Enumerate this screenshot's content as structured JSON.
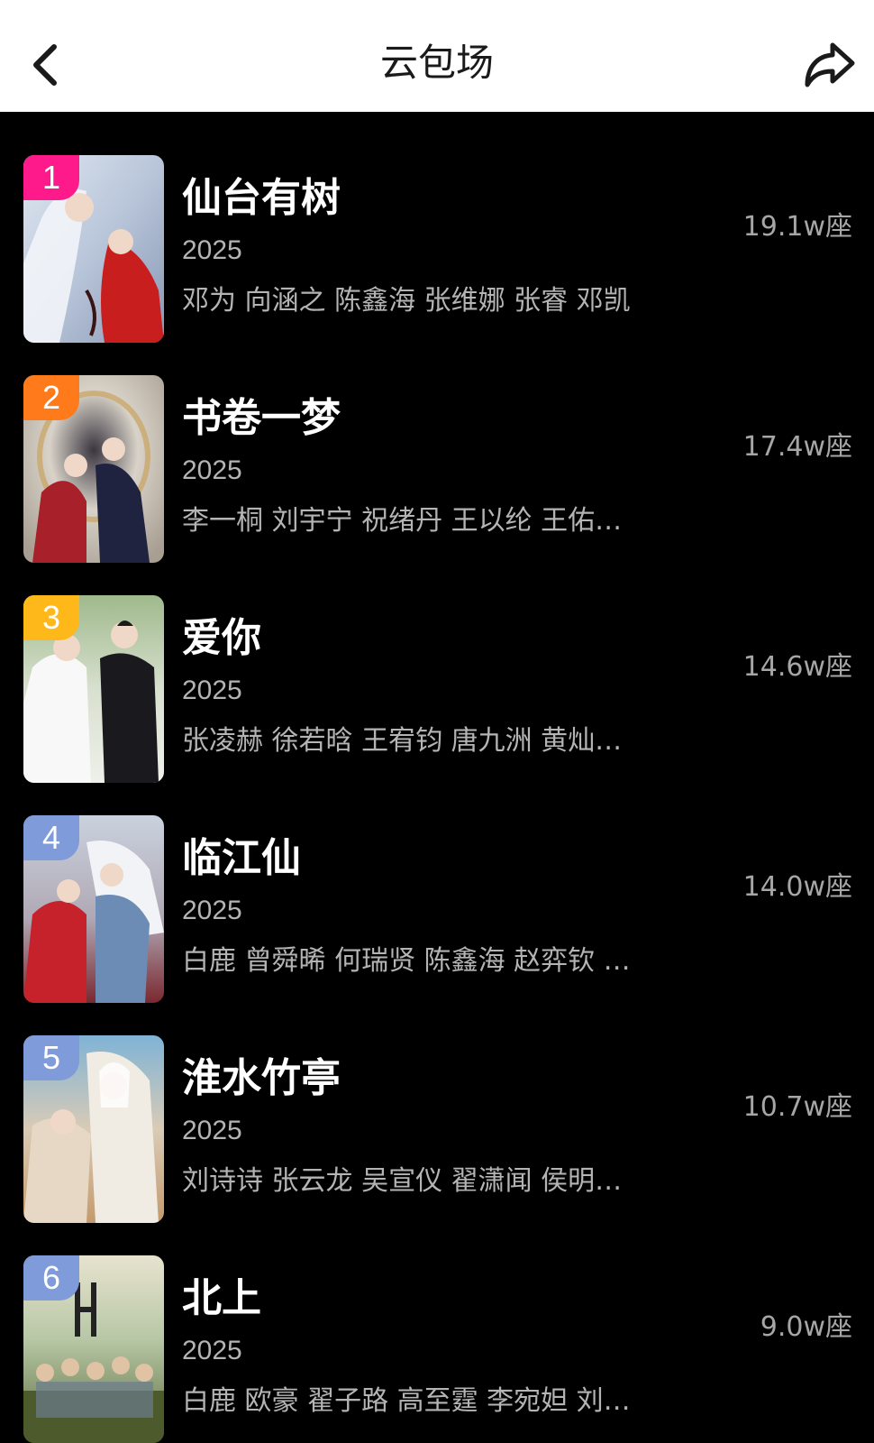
{
  "header": {
    "title": "云包场",
    "back_icon": "chevron-left-icon",
    "share_icon": "share-arrow-icon"
  },
  "items": [
    {
      "rank": "1",
      "title": "仙台有树",
      "year": "2025",
      "cast": "邓为 向涵之 陈鑫海 张维娜 张睿 邓凯",
      "seats": "19.1w座",
      "badge_color": "#ff1a8c"
    },
    {
      "rank": "2",
      "title": "书卷一梦",
      "year": "2025",
      "cast": "李一桐 刘宇宁 祝绪丹 王以纶 王佑…",
      "seats": "17.4w座",
      "badge_color": "#ff7a1a"
    },
    {
      "rank": "3",
      "title": "爱你",
      "year": "2025",
      "cast": "张凌赫 徐若晗 王宥钧 唐九洲 黄灿…",
      "seats": "14.6w座",
      "badge_color": "#ffb81a"
    },
    {
      "rank": "4",
      "title": "临江仙",
      "year": "2025",
      "cast": "白鹿 曾舜晞 何瑞贤 陈鑫海 赵弈钦 …",
      "seats": "14.0w座",
      "badge_color": "#7f9bd9"
    },
    {
      "rank": "5",
      "title": "淮水竹亭",
      "year": "2025",
      "cast": "刘诗诗 张云龙 吴宣仪 翟潇闻 侯明…",
      "seats": "10.7w座",
      "badge_color": "#7f9bd9"
    },
    {
      "rank": "6",
      "title": "北上",
      "year": "2025",
      "cast": "白鹿 欧豪 翟子路 高至霆 李宛妲 刘…",
      "seats": "9.0w座",
      "badge_color": "#7f9bd9"
    }
  ]
}
